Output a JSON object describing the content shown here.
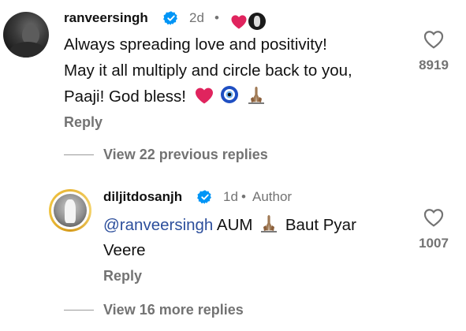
{
  "comment": {
    "username": "ranveersingh",
    "time": "2d",
    "dot": "•",
    "lines": [
      "Always spreading love and positivity!",
      "May it all multiply and circle back to you,",
      "Paaji! God bless!"
    ],
    "like_count": "8919",
    "reply_label": "Reply"
  },
  "previous_replies": {
    "label": "View 22 previous replies"
  },
  "reply": {
    "username": "diljitdosanjh",
    "time": "1d",
    "dot": "•",
    "role": "Author",
    "mention": "@ranveersingh",
    "text_part1": "AUM",
    "text_part2": "Baut Pyar",
    "line2": "Veere",
    "like_count": "1007",
    "reply_label": "Reply"
  },
  "more_replies": {
    "label": "View 16 more replies"
  },
  "colors": {
    "verified": "#0095f6",
    "heart": "#e0245e",
    "secondary_text": "#737373",
    "mention": "#2d4f9c"
  },
  "icons": [
    "verified-badge-icon",
    "heart-icon",
    "evil-eye-icon",
    "praying-hands-icon",
    "heart-outline-icon"
  ]
}
